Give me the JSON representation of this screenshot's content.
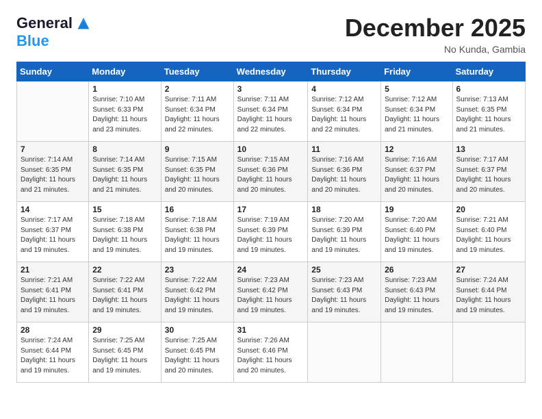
{
  "logo": {
    "line1": "General",
    "line2": "Blue"
  },
  "title": "December 2025",
  "location": "No Kunda, Gambia",
  "days_header": [
    "Sunday",
    "Monday",
    "Tuesday",
    "Wednesday",
    "Thursday",
    "Friday",
    "Saturday"
  ],
  "weeks": [
    [
      {
        "day": "",
        "info": ""
      },
      {
        "day": "1",
        "info": "Sunrise: 7:10 AM\nSunset: 6:33 PM\nDaylight: 11 hours\nand 23 minutes."
      },
      {
        "day": "2",
        "info": "Sunrise: 7:11 AM\nSunset: 6:34 PM\nDaylight: 11 hours\nand 22 minutes."
      },
      {
        "day": "3",
        "info": "Sunrise: 7:11 AM\nSunset: 6:34 PM\nDaylight: 11 hours\nand 22 minutes."
      },
      {
        "day": "4",
        "info": "Sunrise: 7:12 AM\nSunset: 6:34 PM\nDaylight: 11 hours\nand 22 minutes."
      },
      {
        "day": "5",
        "info": "Sunrise: 7:12 AM\nSunset: 6:34 PM\nDaylight: 11 hours\nand 21 minutes."
      },
      {
        "day": "6",
        "info": "Sunrise: 7:13 AM\nSunset: 6:35 PM\nDaylight: 11 hours\nand 21 minutes."
      }
    ],
    [
      {
        "day": "7",
        "info": "Sunrise: 7:14 AM\nSunset: 6:35 PM\nDaylight: 11 hours\nand 21 minutes."
      },
      {
        "day": "8",
        "info": "Sunrise: 7:14 AM\nSunset: 6:35 PM\nDaylight: 11 hours\nand 21 minutes."
      },
      {
        "day": "9",
        "info": "Sunrise: 7:15 AM\nSunset: 6:35 PM\nDaylight: 11 hours\nand 20 minutes."
      },
      {
        "day": "10",
        "info": "Sunrise: 7:15 AM\nSunset: 6:36 PM\nDaylight: 11 hours\nand 20 minutes."
      },
      {
        "day": "11",
        "info": "Sunrise: 7:16 AM\nSunset: 6:36 PM\nDaylight: 11 hours\nand 20 minutes."
      },
      {
        "day": "12",
        "info": "Sunrise: 7:16 AM\nSunset: 6:37 PM\nDaylight: 11 hours\nand 20 minutes."
      },
      {
        "day": "13",
        "info": "Sunrise: 7:17 AM\nSunset: 6:37 PM\nDaylight: 11 hours\nand 20 minutes."
      }
    ],
    [
      {
        "day": "14",
        "info": "Sunrise: 7:17 AM\nSunset: 6:37 PM\nDaylight: 11 hours\nand 19 minutes."
      },
      {
        "day": "15",
        "info": "Sunrise: 7:18 AM\nSunset: 6:38 PM\nDaylight: 11 hours\nand 19 minutes."
      },
      {
        "day": "16",
        "info": "Sunrise: 7:18 AM\nSunset: 6:38 PM\nDaylight: 11 hours\nand 19 minutes."
      },
      {
        "day": "17",
        "info": "Sunrise: 7:19 AM\nSunset: 6:39 PM\nDaylight: 11 hours\nand 19 minutes."
      },
      {
        "day": "18",
        "info": "Sunrise: 7:20 AM\nSunset: 6:39 PM\nDaylight: 11 hours\nand 19 minutes."
      },
      {
        "day": "19",
        "info": "Sunrise: 7:20 AM\nSunset: 6:40 PM\nDaylight: 11 hours\nand 19 minutes."
      },
      {
        "day": "20",
        "info": "Sunrise: 7:21 AM\nSunset: 6:40 PM\nDaylight: 11 hours\nand 19 minutes."
      }
    ],
    [
      {
        "day": "21",
        "info": "Sunrise: 7:21 AM\nSunset: 6:41 PM\nDaylight: 11 hours\nand 19 minutes."
      },
      {
        "day": "22",
        "info": "Sunrise: 7:22 AM\nSunset: 6:41 PM\nDaylight: 11 hours\nand 19 minutes."
      },
      {
        "day": "23",
        "info": "Sunrise: 7:22 AM\nSunset: 6:42 PM\nDaylight: 11 hours\nand 19 minutes."
      },
      {
        "day": "24",
        "info": "Sunrise: 7:23 AM\nSunset: 6:42 PM\nDaylight: 11 hours\nand 19 minutes."
      },
      {
        "day": "25",
        "info": "Sunrise: 7:23 AM\nSunset: 6:43 PM\nDaylight: 11 hours\nand 19 minutes."
      },
      {
        "day": "26",
        "info": "Sunrise: 7:23 AM\nSunset: 6:43 PM\nDaylight: 11 hours\nand 19 minutes."
      },
      {
        "day": "27",
        "info": "Sunrise: 7:24 AM\nSunset: 6:44 PM\nDaylight: 11 hours\nand 19 minutes."
      }
    ],
    [
      {
        "day": "28",
        "info": "Sunrise: 7:24 AM\nSunset: 6:44 PM\nDaylight: 11 hours\nand 19 minutes."
      },
      {
        "day": "29",
        "info": "Sunrise: 7:25 AM\nSunset: 6:45 PM\nDaylight: 11 hours\nand 19 minutes."
      },
      {
        "day": "30",
        "info": "Sunrise: 7:25 AM\nSunset: 6:45 PM\nDaylight: 11 hours\nand 20 minutes."
      },
      {
        "day": "31",
        "info": "Sunrise: 7:26 AM\nSunset: 6:46 PM\nDaylight: 11 hours\nand 20 minutes."
      },
      {
        "day": "",
        "info": ""
      },
      {
        "day": "",
        "info": ""
      },
      {
        "day": "",
        "info": ""
      }
    ]
  ]
}
